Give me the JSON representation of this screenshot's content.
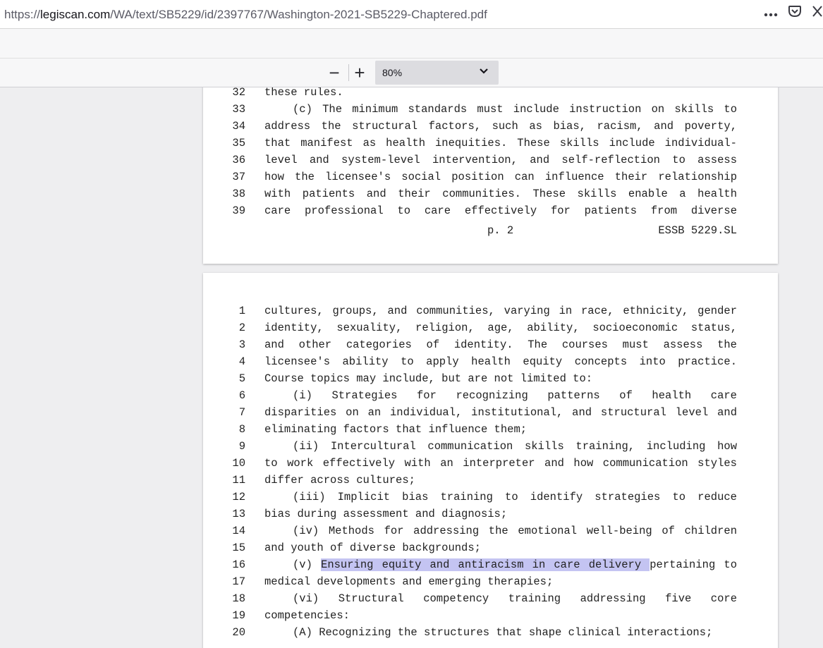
{
  "browser": {
    "url_prefix": "https://",
    "url_host": "legiscan.com",
    "url_path": "/WA/text/SB5229/id/2397767/Washington-2021-SB5229-Chaptered.pdf",
    "icons": [
      "more-icon",
      "pocket-icon",
      "extensions-icon"
    ]
  },
  "pdf_toolbar": {
    "zoom_out_label": "−",
    "zoom_in_label": "+",
    "zoom_value": "80%"
  },
  "page1": {
    "lines": [
      {
        "n": "32",
        "t": "these rules."
      },
      {
        "n": "33",
        "t": "(c) The minimum standards must include instruction on skills to"
      },
      {
        "n": "34",
        "t": "address the structural factors, such as bias, racism, and poverty,"
      },
      {
        "n": "35",
        "t": "that manifest as health inequities. These skills include individual-"
      },
      {
        "n": "36",
        "t": "level and system-level intervention, and self-reflection to assess"
      },
      {
        "n": "37",
        "t": "how the licensee's social position can influence their relationship"
      },
      {
        "n": "38",
        "t": "with patients and their communities. These skills enable a health"
      },
      {
        "n": "39",
        "t": "care professional to care effectively for patients from diverse"
      }
    ],
    "footer_page": "p. 2",
    "footer_id": "ESSB 5229.SL"
  },
  "page2": {
    "lines": [
      {
        "n": "1",
        "t": "cultures, groups, and communities, varying in race, ethnicity, gender"
      },
      {
        "n": "2",
        "t": "identity, sexuality, religion, age, ability, socioeconomic status,"
      },
      {
        "n": "3",
        "t": "and other categories of identity. The courses must assess the"
      },
      {
        "n": "4",
        "t": "licensee's ability to apply health equity concepts into practice."
      },
      {
        "n": "5",
        "t": "Course topics may include, but are not limited to:"
      },
      {
        "n": "6",
        "t": "(i) Strategies for recognizing patterns of health care"
      },
      {
        "n": "7",
        "t": "disparities on an individual, institutional, and structural level and"
      },
      {
        "n": "8",
        "t": "eliminating factors that influence them;"
      },
      {
        "n": "9",
        "t": "(ii) Intercultural communication skills training, including how"
      },
      {
        "n": "10",
        "t": "to work effectively with an interpreter and how communication styles"
      },
      {
        "n": "11",
        "t": "differ across cultures;"
      },
      {
        "n": "12",
        "t": "(iii) Implicit bias training to identify strategies to reduce"
      },
      {
        "n": "13",
        "t": "bias during assessment and diagnosis;"
      },
      {
        "n": "14",
        "t": "(iv) Methods for addressing the emotional well-being of children"
      },
      {
        "n": "15",
        "t": "and youth of diverse backgrounds;"
      },
      {
        "n": "16",
        "t_pre": "(v) ",
        "t_hl": "Ensuring equity and antiracism in care delivery ",
        "t_post": "pertaining to"
      },
      {
        "n": "17",
        "t": "medical developments and emerging therapies;"
      },
      {
        "n": "18",
        "t": "(vi) Structural competency training addressing five core"
      },
      {
        "n": "19",
        "t": "competencies:"
      },
      {
        "n": "20",
        "t": "(A) Recognizing the structures that shape clinical interactions;"
      }
    ]
  },
  "colors": {
    "highlight": "#c4c4f2",
    "page_bg": "#ffffff",
    "viewer_bg": "#eeeef0"
  }
}
